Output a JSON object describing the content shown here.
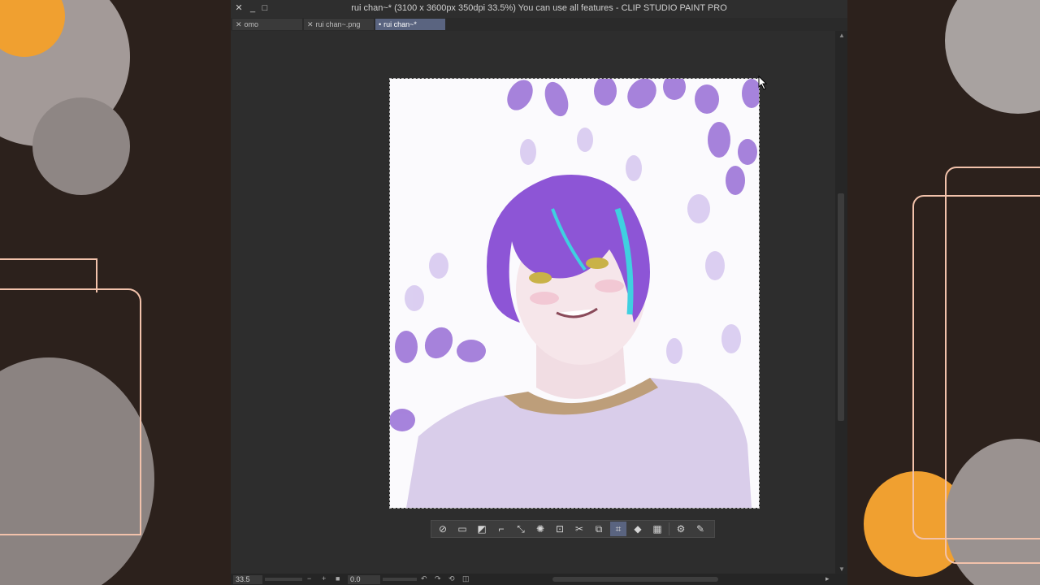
{
  "window": {
    "title": "rui chan~* (3100 x 3600px 350dpi 33.5%)  You can use all features - CLIP STUDIO PAINT PRO"
  },
  "tabs": [
    {
      "label": "omo",
      "active": false
    },
    {
      "label": "rui chan~.png",
      "active": false
    },
    {
      "label": "rui chan~*",
      "active": true
    }
  ],
  "statusbar": {
    "zoom_value": "33.5",
    "rotation_value": "0.0"
  },
  "toolbar": {
    "icons": [
      "deselect-icon",
      "select-all-icon",
      "invert-selection-icon",
      "transform-icon",
      "scale-icon",
      "expand-selection-icon",
      "shrink-selection-icon",
      "cut-icon",
      "copy-paste-icon",
      "crop-icon",
      "fill-icon",
      "clear-icon",
      "settings-icon",
      "pen-icon"
    ],
    "active_icon": "crop-icon"
  },
  "colors": {
    "app_bg": "#2b2b2b",
    "accent": "#5a6480",
    "artwork_purple": "#8a5bd0"
  }
}
